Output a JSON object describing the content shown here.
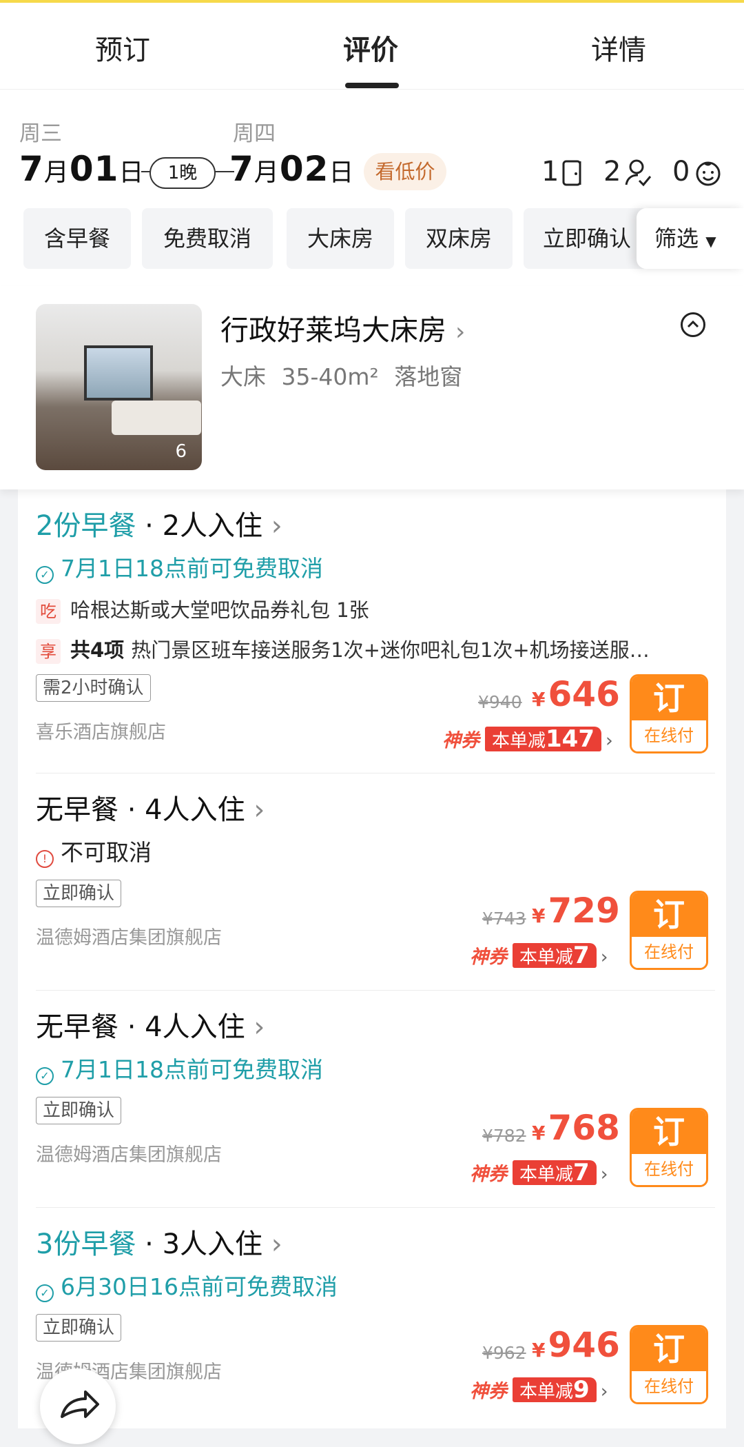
{
  "tabs": [
    "预订",
    "评价",
    "详情"
  ],
  "dates": {
    "checkin_weekday": "周三",
    "checkin_month": "7",
    "checkin_day": "01",
    "month_unit": "月",
    "day_unit": "日",
    "nights": "1晚",
    "checkout_weekday": "周四",
    "checkout_month": "7",
    "checkout_day": "02",
    "low_price": "看低价",
    "rooms": "1",
    "adults": "2",
    "children": "0"
  },
  "filters": [
    "含早餐",
    "免费取消",
    "大床房",
    "双床房",
    "立即确认"
  ],
  "filter_button": "筛选",
  "room": {
    "title": "行政好莱坞大床房",
    "attrs": "大床 35-40m² 落地窗",
    "photo_count": "6"
  },
  "offers": [
    {
      "meal": "2份早餐",
      "meal_teal": true,
      "guests": " · 2人入住",
      "cancel": "7月1日18点前可免费取消",
      "cancel_ok": true,
      "perk1_tag": "吃",
      "perk1_text": "哈根达斯或大堂吧饮品券礼包 1张",
      "perk2_tag": "享",
      "perk2_bold": "共4项",
      "perk2_text": "热门景区班车接送服务1次+迷你吧礼包1次+机场接送服…",
      "confirm": "需2小时确认",
      "seller": "喜乐酒店旗舰店",
      "orig_price": "¥940",
      "price": "646",
      "coupon_label": "神券",
      "coupon_text": "本单减",
      "coupon_amount": "147"
    },
    {
      "meal": "无早餐",
      "meal_teal": false,
      "guests": " · 4人入住",
      "cancel": "不可取消",
      "cancel_ok": false,
      "confirm": "立即确认",
      "seller": "温德姆酒店集团旗舰店",
      "orig_price": "¥743",
      "price": "729",
      "coupon_label": "神券",
      "coupon_text": "本单减",
      "coupon_amount": "7"
    },
    {
      "meal": "无早餐",
      "meal_teal": false,
      "guests": " · 4人入住",
      "cancel": "7月1日18点前可免费取消",
      "cancel_ok": true,
      "confirm": "立即确认",
      "seller": "温德姆酒店集团旗舰店",
      "orig_price": "¥782",
      "price": "768",
      "coupon_label": "神券",
      "coupon_text": "本单减",
      "coupon_amount": "7"
    },
    {
      "meal": "3份早餐",
      "meal_teal": true,
      "guests": " · 3人入住",
      "cancel": "6月30日16点前可免费取消",
      "cancel_ok": true,
      "confirm": "立即确认",
      "seller": "温德姆酒店集团旗舰店",
      "orig_price": "¥962",
      "price": "946",
      "coupon_label": "神券",
      "coupon_text": "本单减",
      "coupon_amount": "9"
    }
  ],
  "book": {
    "label": "订",
    "sub": "在线付"
  },
  "currency": "¥",
  "colors": {
    "teal": "#1f9ea8",
    "price_red": "#f0503c",
    "book_orange": "#ff8a1a"
  }
}
